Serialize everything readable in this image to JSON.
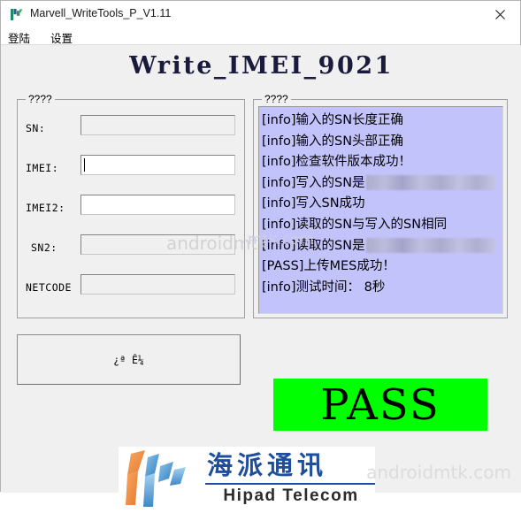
{
  "window": {
    "title": "Marvell_WriteTools_P_V1.11",
    "icon": "app-logo-icon",
    "close_label": "✕"
  },
  "menubar": {
    "items": [
      {
        "label": "登陆",
        "name": "menu-login"
      },
      {
        "label": "设置",
        "name": "menu-settings"
      }
    ]
  },
  "heading": "Write_IMEI_9021",
  "form": {
    "legend": "????",
    "fields": [
      {
        "label": "SN:",
        "value": "",
        "placeholder": "",
        "enabled": false,
        "focused": false
      },
      {
        "label": "IMEI:",
        "value": "",
        "placeholder": "",
        "enabled": true,
        "focused": true
      },
      {
        "label": "IMEI2:",
        "value": "",
        "placeholder": "",
        "enabled": true,
        "focused": false
      },
      {
        "label": "SN2:",
        "value": "",
        "placeholder": "",
        "enabled": false,
        "focused": false
      },
      {
        "label": "NETCODE",
        "value": "",
        "placeholder": "",
        "enabled": false,
        "focused": false
      }
    ]
  },
  "log": {
    "legend": "????",
    "background_color": "#c3c3fb",
    "lines": [
      {
        "text": "[info]输入的SN长度正确",
        "redacted": false
      },
      {
        "text": "[info]输入的SN头部正确",
        "redacted": false
      },
      {
        "text": "[info]检查软件版本成功！",
        "redacted": false
      },
      {
        "text": "[info]写入的SN是",
        "redacted": true
      },
      {
        "text": "[info]写入SN成功",
        "redacted": false
      },
      {
        "text": "[info]读取的SN与写入的SN相同",
        "redacted": false
      },
      {
        "text": "[info]读取的SN是",
        "redacted": true
      },
      {
        "text": "[PASS]上传MES成功！",
        "redacted": false
      },
      {
        "text": "[info]测试时间：  8秒",
        "redacted": false
      }
    ]
  },
  "start_button": {
    "label": "¿ª Ê¼"
  },
  "status_banner": {
    "text": "PASS",
    "background_color": "#00ff00",
    "text_color": "#000000"
  },
  "logo": {
    "chinese": "海派通讯",
    "english": "Hipad Telecom",
    "brand_color": "#1f4e9c",
    "accent_color": "#ef8b3f"
  },
  "watermarks": {
    "main": "androidmtk.com",
    "middle": "androidmtk",
    "log": "mtk.com"
  }
}
